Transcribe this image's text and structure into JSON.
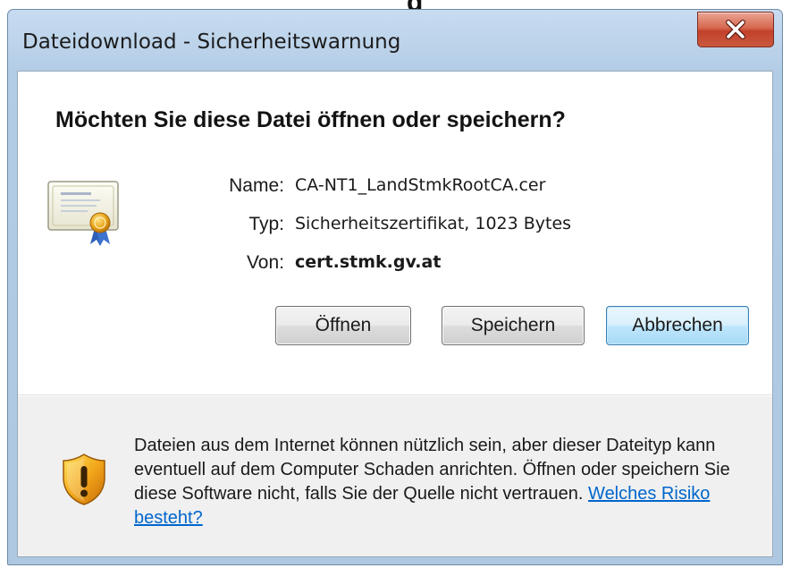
{
  "page": {
    "heading_fragment": "g"
  },
  "window": {
    "title": "Dateidownload - Sicherheitswarnung",
    "close_icon": "close-icon",
    "close_color": "#c2402a"
  },
  "dialog": {
    "question": "Möchten Sie diese Datei öffnen oder speichern?",
    "file_icon": "certificate-icon",
    "fields": {
      "name_label": "Name:",
      "name_value": "CA-NT1_LandStmkRootCA.cer",
      "type_label": "Typ:",
      "type_value": "Sicherheitszertifikat, 1023 Bytes",
      "from_label": "Von:",
      "from_value": "cert.stmk.gv.at"
    },
    "buttons": {
      "open": "Öffnen",
      "save": "Speichern",
      "cancel": "Abbrechen"
    }
  },
  "warning": {
    "icon": "shield-warning-icon",
    "text": "Dateien aus dem Internet können nützlich sein, aber dieser Dateityp kann eventuell auf dem Computer Schaden anrichten. Öffnen oder speichern Sie diese Software nicht, falls Sie der Quelle nicht vertrauen.",
    "link": "Welches Risiko besteht?",
    "link_color": "#0066cc"
  }
}
